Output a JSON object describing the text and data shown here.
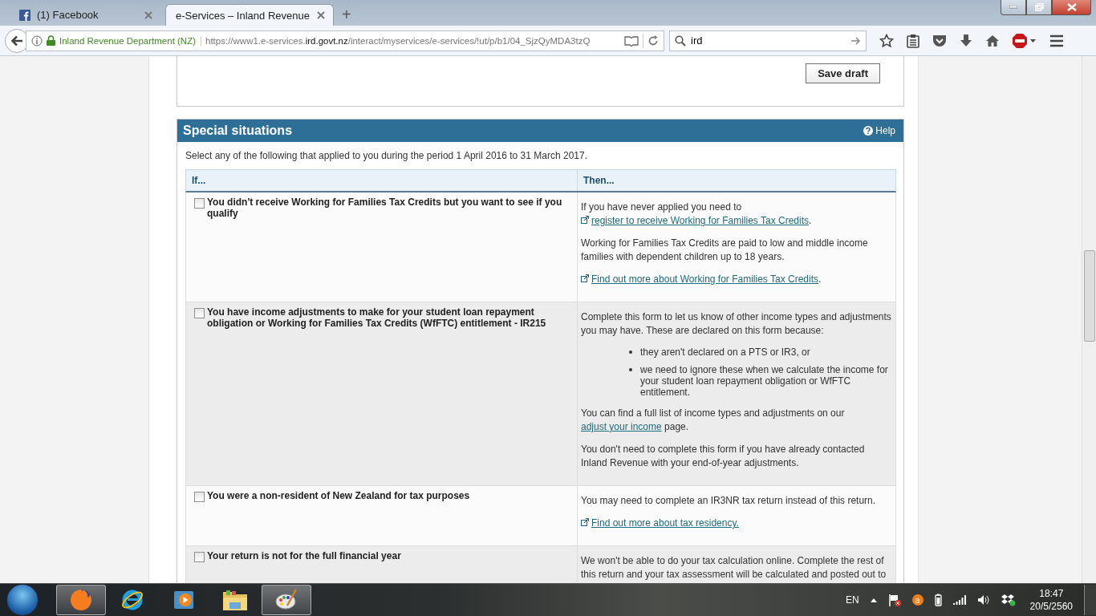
{
  "browser": {
    "tabs": [
      {
        "title": "(1) Facebook",
        "favicon": true,
        "selected": false
      },
      {
        "title": "e-Services – Inland Revenue",
        "favicon": false,
        "selected": true
      }
    ],
    "new_tab": "+",
    "identity": "Inland Revenue Department (NZ)",
    "url": {
      "prefix": "https://www1.e-services.",
      "domain": "ird.govt.nz",
      "path": "/interact/myservices/e-services/!ut/p/b1/04_SjzQyMDA3tzQ"
    },
    "search": {
      "value": "ird"
    }
  },
  "page": {
    "save_button": "Save draft",
    "section": {
      "title": "Special situations",
      "help": "Help",
      "intro": "Select any of the following that applied to you during the period 1 April 2016 to 31 March 2017.",
      "columns": [
        "If...",
        "Then..."
      ],
      "rows": [
        {
          "condition": "You didn't receive Working for Families Tax Credits but you want to see if you qualify",
          "checked": false,
          "shaded": false,
          "then": [
            {
              "kind": "para",
              "parts": [
                {
                  "kind": "text",
                  "text": "If you have never applied you need to "
                },
                {
                  "kind": "link",
                  "text": "register to receive Working for Families Tax Credits",
                  "external": true
                },
                {
                  "kind": "text",
                  "text": "."
                }
              ]
            },
            {
              "kind": "para",
              "parts": [
                {
                  "kind": "text",
                  "text": "Working for Families Tax Credits are paid to low and middle income families with dependent children up to 18 years."
                }
              ]
            },
            {
              "kind": "para",
              "parts": [
                {
                  "kind": "link",
                  "text": "Find out more about Working for Families Tax Credits",
                  "external": true
                },
                {
                  "kind": "text",
                  "text": "."
                }
              ]
            }
          ]
        },
        {
          "condition": "You have income adjustments to make for your student loan repayment obligation or Working for Families Tax Credits (WfFTC) entitlement - IR215",
          "checked": false,
          "shaded": true,
          "then": [
            {
              "kind": "para",
              "parts": [
                {
                  "kind": "text",
                  "text": "Complete this form to let us know of other income types and adjustments you may have. These are declared on this form because:"
                }
              ]
            },
            {
              "kind": "list",
              "items": [
                "they aren't declared on a PTS or IR3, or",
                "we need to ignore these when we calculate the income for your student loan repayment obligation or WfFTC entitlement."
              ]
            },
            {
              "kind": "para",
              "parts": [
                {
                  "kind": "text",
                  "text": "You can find a full list of income types and adjustments on our "
                },
                {
                  "kind": "link",
                  "text": "adjust your income",
                  "external": false
                },
                {
                  "kind": "text",
                  "text": " page."
                }
              ]
            },
            {
              "kind": "para",
              "parts": [
                {
                  "kind": "text",
                  "text": "You don't need to complete this form if you have already contacted Inland Revenue with your end-of-year adjustments."
                }
              ]
            }
          ]
        },
        {
          "condition": "You were a non-resident of New Zealand for tax purposes",
          "checked": false,
          "shaded": false,
          "then": [
            {
              "kind": "para",
              "parts": [
                {
                  "kind": "text",
                  "text": "You may need to complete an IR3NR tax return instead of this return."
                }
              ]
            },
            {
              "kind": "para",
              "parts": [
                {
                  "kind": "link",
                  "text": "Find out more about tax residency.",
                  "external": true
                }
              ]
            }
          ]
        },
        {
          "condition": "Your return is not for the full financial year",
          "checked": false,
          "shaded": true,
          "then": [
            {
              "kind": "para",
              "parts": [
                {
                  "kind": "text",
                  "text": "We won't be able to do your tax calculation online. Complete the rest of this return and your tax assessment will be calculated and posted out to"
                }
              ]
            }
          ]
        }
      ]
    }
  },
  "taskbar": {
    "apps": [
      {
        "kind": "firefox",
        "active": true
      },
      {
        "kind": "ie",
        "active": false
      },
      {
        "kind": "media",
        "active": false
      },
      {
        "kind": "explorer",
        "active": false
      },
      {
        "kind": "paint",
        "active": true
      }
    ],
    "language": "EN",
    "tray_badge": "a",
    "time": "18:47",
    "date": "20/5/2560"
  }
}
